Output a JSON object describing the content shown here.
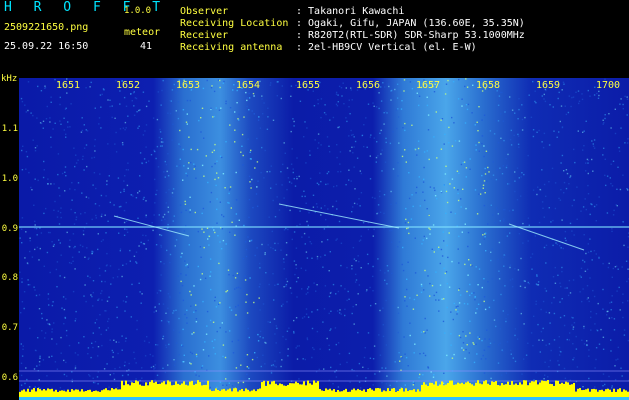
{
  "app": {
    "name": "H R O F F T",
    "version": "1.0.0"
  },
  "file": {
    "name": "2509221650.png",
    "datetime": "25.09.22 16:50"
  },
  "meteor": {
    "label": "meteor",
    "count": "41"
  },
  "info": [
    {
      "key": "Observer",
      "value": ": Takanori Kawachi"
    },
    {
      "key": "Receiving Location",
      "value": ": Ogaki, Gifu, JAPAN (136.60E, 35.35N)"
    },
    {
      "key": "Receiver",
      "value": ": R820T2(RTL-SDR) SDR-Sharp 53.1000MHz"
    },
    {
      "key": "Receiving antenna",
      "value": ": 2el-HB9CV Vertical (el. E-W)"
    }
  ],
  "axis": {
    "unit": "kHz",
    "y_ticks": [
      "1.1",
      "1.0",
      "0.9",
      "0.8",
      "0.7",
      "0.6"
    ],
    "x_ticks": [
      "1651",
      "1652",
      "1653",
      "1654",
      "1655",
      "1656",
      "1657",
      "1658",
      "1659",
      "1700"
    ]
  },
  "colors": {
    "background": "#00008a",
    "label": "#ffff40",
    "header": "#00e5ff",
    "carrier": "#7fe0ff",
    "power": "#ffff00"
  }
}
